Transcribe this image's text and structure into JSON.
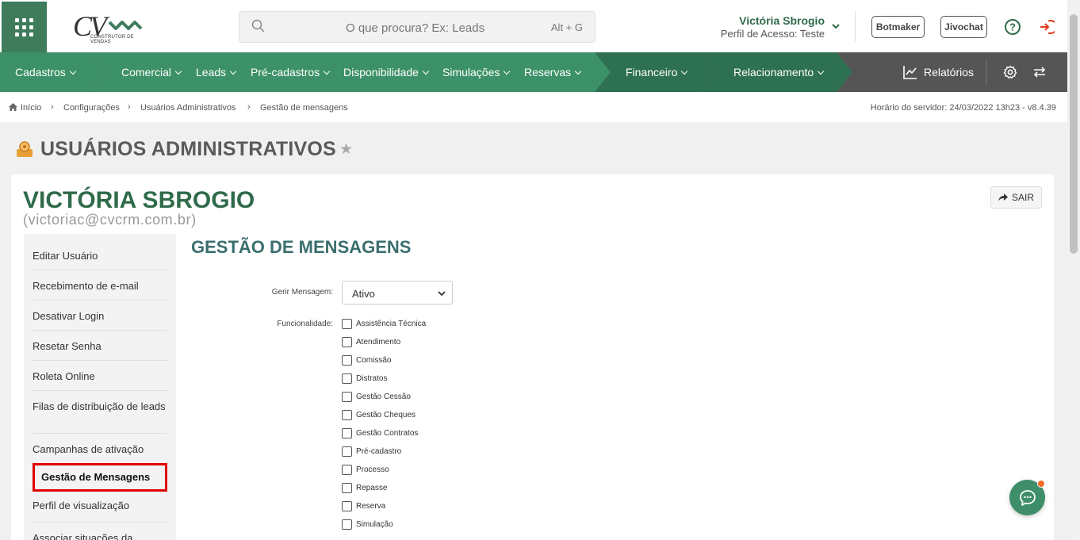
{
  "header": {
    "logo_text": "CV",
    "logo_subtitle": "CONSTRUTOR DE VENDAS",
    "search_placeholder": "O que procura? Ex: Leads",
    "search_hotkey": "Alt + G",
    "user_name": "Victória Sbrogio",
    "user_profile": "Perfil de Acesso: Teste",
    "botmaker_label": "Botmaker",
    "jivochat_label": "Jivochat"
  },
  "nav": {
    "items": [
      "Cadastros",
      "Comercial",
      "Leads",
      "Pré-cadastros",
      "Disponibilidade",
      "Simulações",
      "Reservas",
      "Financeiro",
      "Relacionamento"
    ],
    "reports_label": "Relatórios"
  },
  "breadcrumb": {
    "items": [
      "Início",
      "Configurações",
      "Usuários Administrativos",
      "Gestão de mensagens"
    ],
    "server_info": "Horário do servidor: 24/03/2022 13h23 - v8.4.39"
  },
  "page": {
    "title": "USUÁRIOS ADMINISTRATIVOS",
    "user_name": "VICTÓRIA SBROGIO",
    "user_email": "(victoriac@cvcrm.com.br)",
    "exit_label": "SAIR"
  },
  "sidebar": {
    "items": [
      "Editar Usuário",
      "Recebimento de e-mail",
      "Desativar Login",
      "Resetar Senha",
      "Roleta Online",
      "Filas de distribuição de leads",
      "Campanhas de ativação",
      "Gestão de Mensagens",
      "Perfil de visualização",
      "Associar situações da"
    ],
    "active_index": 7
  },
  "form": {
    "section_title": "GESTÃO DE MENSAGENS",
    "gerir_label": "Gerir Mensagem:",
    "gerir_value": "Ativo",
    "func_label": "Funcionalidade:",
    "checkboxes": [
      "Assistência Técnica",
      "Atendimento",
      "Comissão",
      "Distratos",
      "Gestão Cessão",
      "Gestão Cheques",
      "Gestão Contratos",
      "Pré-cadastro",
      "Processo",
      "Repasse",
      "Reserva",
      "Simulação"
    ]
  },
  "colors": {
    "brand_green": "#3f7c5c",
    "nav_green": "#3d9168",
    "nav_dark_green": "#2e7052",
    "nav_gray": "#555555",
    "title_green": "#2f6b4a",
    "highlight_red": "#e00000",
    "chat_green": "#3e8f69"
  }
}
